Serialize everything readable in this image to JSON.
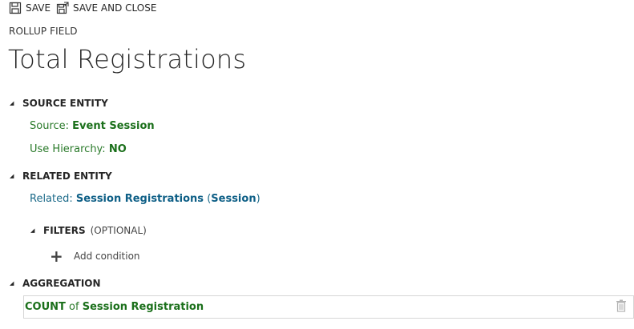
{
  "toolbar": {
    "save_label": "SAVE",
    "save_close_label": "SAVE AND CLOSE"
  },
  "header": {
    "entity_type": "ROLLUP FIELD",
    "title": "Total Registrations"
  },
  "source_section": {
    "title": "SOURCE ENTITY",
    "source_label": "Source:",
    "source_value": "Event Session",
    "hierarchy_label": "Use Hierarchy:",
    "hierarchy_value": "NO"
  },
  "related_section": {
    "title": "RELATED ENTITY",
    "related_label": "Related:",
    "related_value": "Session Registrations",
    "related_paren_value": "Session"
  },
  "filters_section": {
    "title": "FILTERS",
    "optional_label": "(OPTIONAL)",
    "add_condition_label": "Add condition"
  },
  "aggregation_section": {
    "title": "AGGREGATION",
    "function": "COUNT",
    "of_label": "of",
    "target": "Session Registration"
  },
  "colors": {
    "green_text": "#1a6f1a",
    "blue_text": "#0e5f86",
    "border": "#d6d6d6"
  },
  "icons": {
    "save": "floppy-disk-icon",
    "save_close": "save-and-close-icon",
    "collapse": "triangle-collapse-icon",
    "add": "plus-icon",
    "delete": "trash-icon"
  }
}
